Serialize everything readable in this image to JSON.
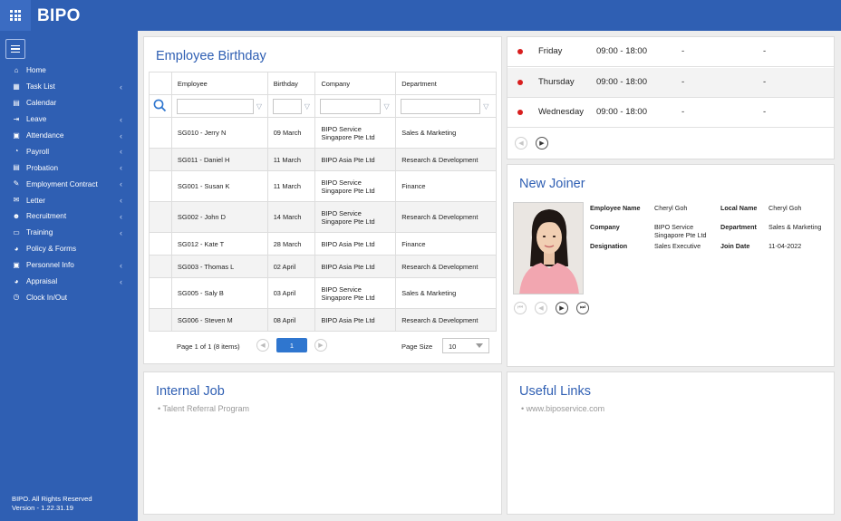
{
  "app": {
    "brand": "BIPO"
  },
  "sidebar": {
    "items": [
      {
        "label": "Home",
        "icon": "home-icon",
        "glyph": "⌂",
        "chevron": false
      },
      {
        "label": "Task List",
        "icon": "task-list-icon",
        "glyph": "▦",
        "chevron": true
      },
      {
        "label": "Calendar",
        "icon": "calendar-icon",
        "glyph": "▤",
        "chevron": false
      },
      {
        "label": "Leave",
        "icon": "leave-icon",
        "glyph": "⇥",
        "chevron": true
      },
      {
        "label": "Attendance",
        "icon": "attendance-icon",
        "glyph": "▣",
        "chevron": true
      },
      {
        "label": "Payroll",
        "icon": "payroll-icon",
        "glyph": "◔",
        "chevron": true
      },
      {
        "label": "Probation",
        "icon": "probation-icon",
        "glyph": "▤",
        "chevron": true
      },
      {
        "label": "Employment Contract",
        "icon": "contract-icon",
        "glyph": "✎",
        "chevron": true
      },
      {
        "label": "Letter",
        "icon": "letter-icon",
        "glyph": "✉",
        "chevron": true
      },
      {
        "label": "Recruitment",
        "icon": "recruitment-icon",
        "glyph": "☻",
        "chevron": true
      },
      {
        "label": "Training",
        "icon": "training-icon",
        "glyph": "▭",
        "chevron": true
      },
      {
        "label": "Policy & Forms",
        "icon": "policy-icon",
        "glyph": "◕",
        "chevron": false
      },
      {
        "label": "Personnel Info",
        "icon": "personnel-info-icon",
        "glyph": "▣",
        "chevron": true
      },
      {
        "label": "Appraisal",
        "icon": "appraisal-icon",
        "glyph": "◕",
        "chevron": true
      },
      {
        "label": "Clock In/Out",
        "icon": "clock-icon",
        "glyph": "◷",
        "chevron": false
      }
    ],
    "footer_line1": "BIPO. All Rights Reserved",
    "footer_line2": "Version - 1.22.31.19"
  },
  "birthday": {
    "title": "Employee Birthday",
    "columns": [
      "Employee",
      "Birthday",
      "Company",
      "Department"
    ],
    "rows": [
      {
        "employee": "SG010 - Jerry N",
        "birthday": "09 March",
        "company1": "BIPO Service",
        "company2": "Singapore Pte Ltd",
        "department": "Sales & Marketing"
      },
      {
        "employee": "SG011 - Daniel H",
        "birthday": "11 March",
        "company1": "BIPO Asia Pte Ltd",
        "company2": "",
        "department": "Research & Development"
      },
      {
        "employee": "SG001 - Susan K",
        "birthday": "11 March",
        "company1": "BIPO Service",
        "company2": "Singapore Pte Ltd",
        "department": "Finance"
      },
      {
        "employee": "SG002 - John D",
        "birthday": "14 March",
        "company1": "BIPO Service",
        "company2": "Singapore Pte Ltd",
        "department": "Research & Development"
      },
      {
        "employee": "SG012 - Kate T",
        "birthday": "28 March",
        "company1": "BIPO Asia Pte Ltd",
        "company2": "",
        "department": "Finance"
      },
      {
        "employee": "SG003 - Thomas L",
        "birthday": "02 April",
        "company1": "BIPO Asia Pte Ltd",
        "company2": "",
        "department": "Research & Development"
      },
      {
        "employee": "SG005 - Saly B",
        "birthday": "03 April",
        "company1": "BIPO Service",
        "company2": "Singapore Pte Ltd",
        "department": "Sales & Marketing"
      },
      {
        "employee": "SG006 - Steven M",
        "birthday": "08 April",
        "company1": "BIPO Asia Pte Ltd",
        "company2": "",
        "department": "Research & Development"
      }
    ],
    "pager": {
      "info": "Page 1 of 1 (8 items)",
      "current": "1",
      "size_label": "Page Size",
      "size": "10"
    }
  },
  "schedule": {
    "rows": [
      {
        "day": "Friday",
        "time": "09:00 - 18:00",
        "a": "-",
        "b": "-"
      },
      {
        "day": "Thursday",
        "time": "09:00 - 18:00",
        "a": "-",
        "b": "-"
      },
      {
        "day": "Wednesday",
        "time": "09:00 - 18:00",
        "a": "-",
        "b": "-"
      }
    ]
  },
  "joiner": {
    "title": "New Joiner",
    "employee_name_label": "Employee Name",
    "employee_name": "Cheryl Goh",
    "local_name_label": "Local Name",
    "local_name": "Cheryl Goh",
    "company_label": "Company",
    "company1": "BIPO Service",
    "company2": "Singapore Pte Ltd",
    "department_label": "Department",
    "department": "Sales & Marketing",
    "designation_label": "Designation",
    "designation": "Sales Executive",
    "join_date_label": "Join Date",
    "join_date": "11-04-2022"
  },
  "internal_job": {
    "title": "Internal Job",
    "item": "• Talent Referral Program"
  },
  "useful_links": {
    "title": "Useful Links",
    "item": "• www.biposervice.com"
  },
  "colors": {
    "brand_blue": "#2f5fb3",
    "accent_blue": "#2f76cf",
    "status_red": "#d81e1e"
  }
}
